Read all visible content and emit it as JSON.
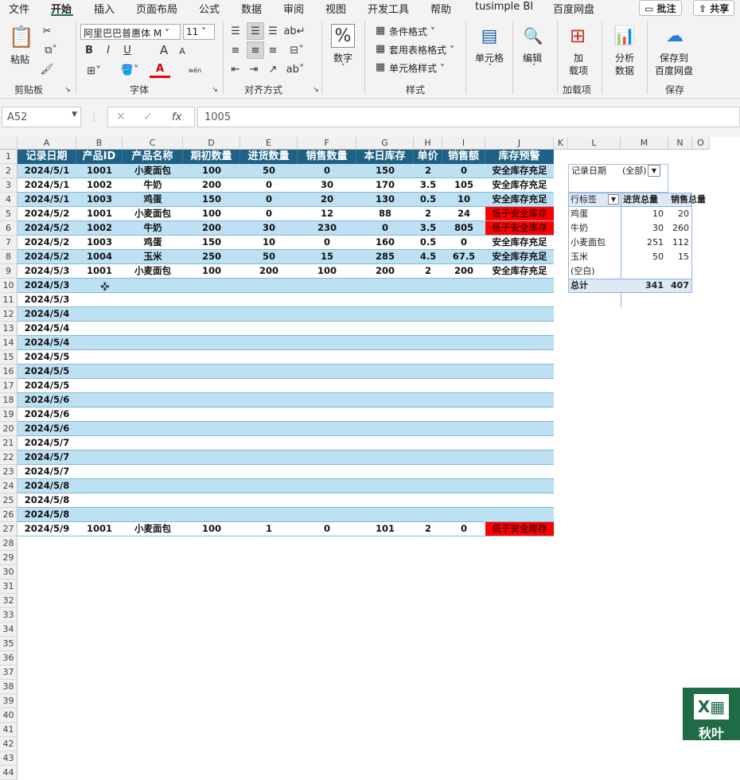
{
  "menu": {
    "items": [
      "文件",
      "开始",
      "插入",
      "页面布局",
      "公式",
      "数据",
      "审阅",
      "视图",
      "开发工具",
      "帮助",
      "tusimple BI",
      "百度网盘"
    ],
    "active_index": 1,
    "comment_button": "批注",
    "share_button": "共享"
  },
  "ribbon": {
    "clipboard": {
      "paste": "粘贴",
      "label": "剪贴板"
    },
    "font": {
      "name": "阿里巴巴普惠体 M",
      "size": "11",
      "label": "字体",
      "bold": "B",
      "italic": "I",
      "underline": "U",
      "grow": "A",
      "shrink": "A",
      "phonetic": "wén"
    },
    "alignment": {
      "label": "对齐方式"
    },
    "number": {
      "button": "数字",
      "symbol": "%"
    },
    "styles": {
      "conditional": "条件格式",
      "table": "套用表格格式",
      "cell_styles": "单元格样式",
      "label": "样式"
    },
    "cells": {
      "button": "单元格"
    },
    "editing": {
      "button": "编辑"
    },
    "addins": {
      "button_line1": "加",
      "button_line2": "载项",
      "label": "加载项"
    },
    "analyze": {
      "line1": "分析",
      "line2": "数据"
    },
    "save": {
      "line1": "保存到",
      "line2": "百度网盘",
      "label": "保存"
    }
  },
  "formula_bar": {
    "name_box": "A52",
    "fx": "fx",
    "value": "1005"
  },
  "columns": [
    "A",
    "B",
    "C",
    "D",
    "E",
    "F",
    "G",
    "H",
    "I",
    "J",
    "K",
    "L",
    "M",
    "N",
    "O"
  ],
  "row_numbers": [
    "1",
    "2",
    "3",
    "4",
    "5",
    "6",
    "7",
    "8",
    "9",
    "10",
    "11",
    "12",
    "13",
    "14",
    "15",
    "16",
    "17",
    "18",
    "19",
    "20",
    "21",
    "22",
    "23",
    "24",
    "25",
    "26",
    "27",
    "28",
    "29",
    "30",
    "31",
    "32",
    "33",
    "34",
    "35",
    "36",
    "37",
    "38",
    "39",
    "40",
    "41",
    "42",
    "43",
    "44"
  ],
  "table": {
    "headers": [
      "记录日期",
      "产品ID",
      "产品名称",
      "期初数量",
      "进货数量",
      "销售数量",
      "本日库存",
      "单价",
      "销售额",
      "库存预警"
    ],
    "rows": [
      [
        "2024/5/1",
        "1001",
        "小麦面包",
        "100",
        "50",
        "0",
        "150",
        "2",
        "0",
        "安全库存充足"
      ],
      [
        "2024/5/1",
        "1002",
        "牛奶",
        "200",
        "0",
        "30",
        "170",
        "3.5",
        "105",
        "安全库存充足"
      ],
      [
        "2024/5/1",
        "1003",
        "鸡蛋",
        "150",
        "0",
        "20",
        "130",
        "0.5",
        "10",
        "安全库存充足"
      ],
      [
        "2024/5/2",
        "1001",
        "小麦面包",
        "100",
        "0",
        "12",
        "88",
        "2",
        "24",
        "低于安全库存"
      ],
      [
        "2024/5/2",
        "1002",
        "牛奶",
        "200",
        "30",
        "230",
        "0",
        "3.5",
        "805",
        "低于安全库存"
      ],
      [
        "2024/5/2",
        "1003",
        "鸡蛋",
        "150",
        "10",
        "0",
        "160",
        "0.5",
        "0",
        "安全库存充足"
      ],
      [
        "2024/5/2",
        "1004",
        "玉米",
        "250",
        "50",
        "15",
        "285",
        "4.5",
        "67.5",
        "安全库存充足"
      ],
      [
        "2024/5/3",
        "1001",
        "小麦面包",
        "100",
        "200",
        "100",
        "200",
        "2",
        "200",
        "安全库存充足"
      ],
      [
        "2024/5/3",
        "",
        "",
        "",
        "",
        "",
        "",
        "",
        "",
        ""
      ],
      [
        "2024/5/3",
        "",
        "",
        "",
        "",
        "",
        "",
        "",
        "",
        ""
      ],
      [
        "2024/5/4",
        "",
        "",
        "",
        "",
        "",
        "",
        "",
        "",
        ""
      ],
      [
        "2024/5/4",
        "",
        "",
        "",
        "",
        "",
        "",
        "",
        "",
        ""
      ],
      [
        "2024/5/4",
        "",
        "",
        "",
        "",
        "",
        "",
        "",
        "",
        ""
      ],
      [
        "2024/5/5",
        "",
        "",
        "",
        "",
        "",
        "",
        "",
        "",
        ""
      ],
      [
        "2024/5/5",
        "",
        "",
        "",
        "",
        "",
        "",
        "",
        "",
        ""
      ],
      [
        "2024/5/5",
        "",
        "",
        "",
        "",
        "",
        "",
        "",
        "",
        ""
      ],
      [
        "2024/5/6",
        "",
        "",
        "",
        "",
        "",
        "",
        "",
        "",
        ""
      ],
      [
        "2024/5/6",
        "",
        "",
        "",
        "",
        "",
        "",
        "",
        "",
        ""
      ],
      [
        "2024/5/6",
        "",
        "",
        "",
        "",
        "",
        "",
        "",
        "",
        ""
      ],
      [
        "2024/5/7",
        "",
        "",
        "",
        "",
        "",
        "",
        "",
        "",
        ""
      ],
      [
        "2024/5/7",
        "",
        "",
        "",
        "",
        "",
        "",
        "",
        "",
        ""
      ],
      [
        "2024/5/7",
        "",
        "",
        "",
        "",
        "",
        "",
        "",
        "",
        ""
      ],
      [
        "2024/5/8",
        "",
        "",
        "",
        "",
        "",
        "",
        "",
        "",
        ""
      ],
      [
        "2024/5/8",
        "",
        "",
        "",
        "",
        "",
        "",
        "",
        "",
        ""
      ],
      [
        "2024/5/8",
        "",
        "",
        "",
        "",
        "",
        "",
        "",
        "",
        ""
      ],
      [
        "2024/5/9",
        "1001",
        "小麦面包",
        "100",
        "1",
        "0",
        "101",
        "2",
        "0",
        "低于安全库存"
      ]
    ],
    "low_stock_label": "低于安全库存"
  },
  "pivot": {
    "filter_label": "记录日期",
    "filter_value": "(全部)",
    "row_label": "行标签",
    "col1": "进货总量",
    "col2": "销售总量",
    "rows": [
      [
        "鸡蛋",
        "10",
        "20"
      ],
      [
        "牛奶",
        "30",
        "260"
      ],
      [
        "小麦面包",
        "251",
        "112"
      ],
      [
        "玉米",
        "50",
        "15"
      ],
      [
        "(空白)",
        "",
        ""
      ]
    ],
    "total": [
      "总计",
      "341",
      "407"
    ]
  },
  "watermark": {
    "text": "秋叶"
  },
  "colors": {
    "header_bg": "#1f6184",
    "band_light": "#bde0f2",
    "low_stock_red": "#ff0000",
    "excel_green": "#217346",
    "pivot_header": "#dde9f6"
  }
}
